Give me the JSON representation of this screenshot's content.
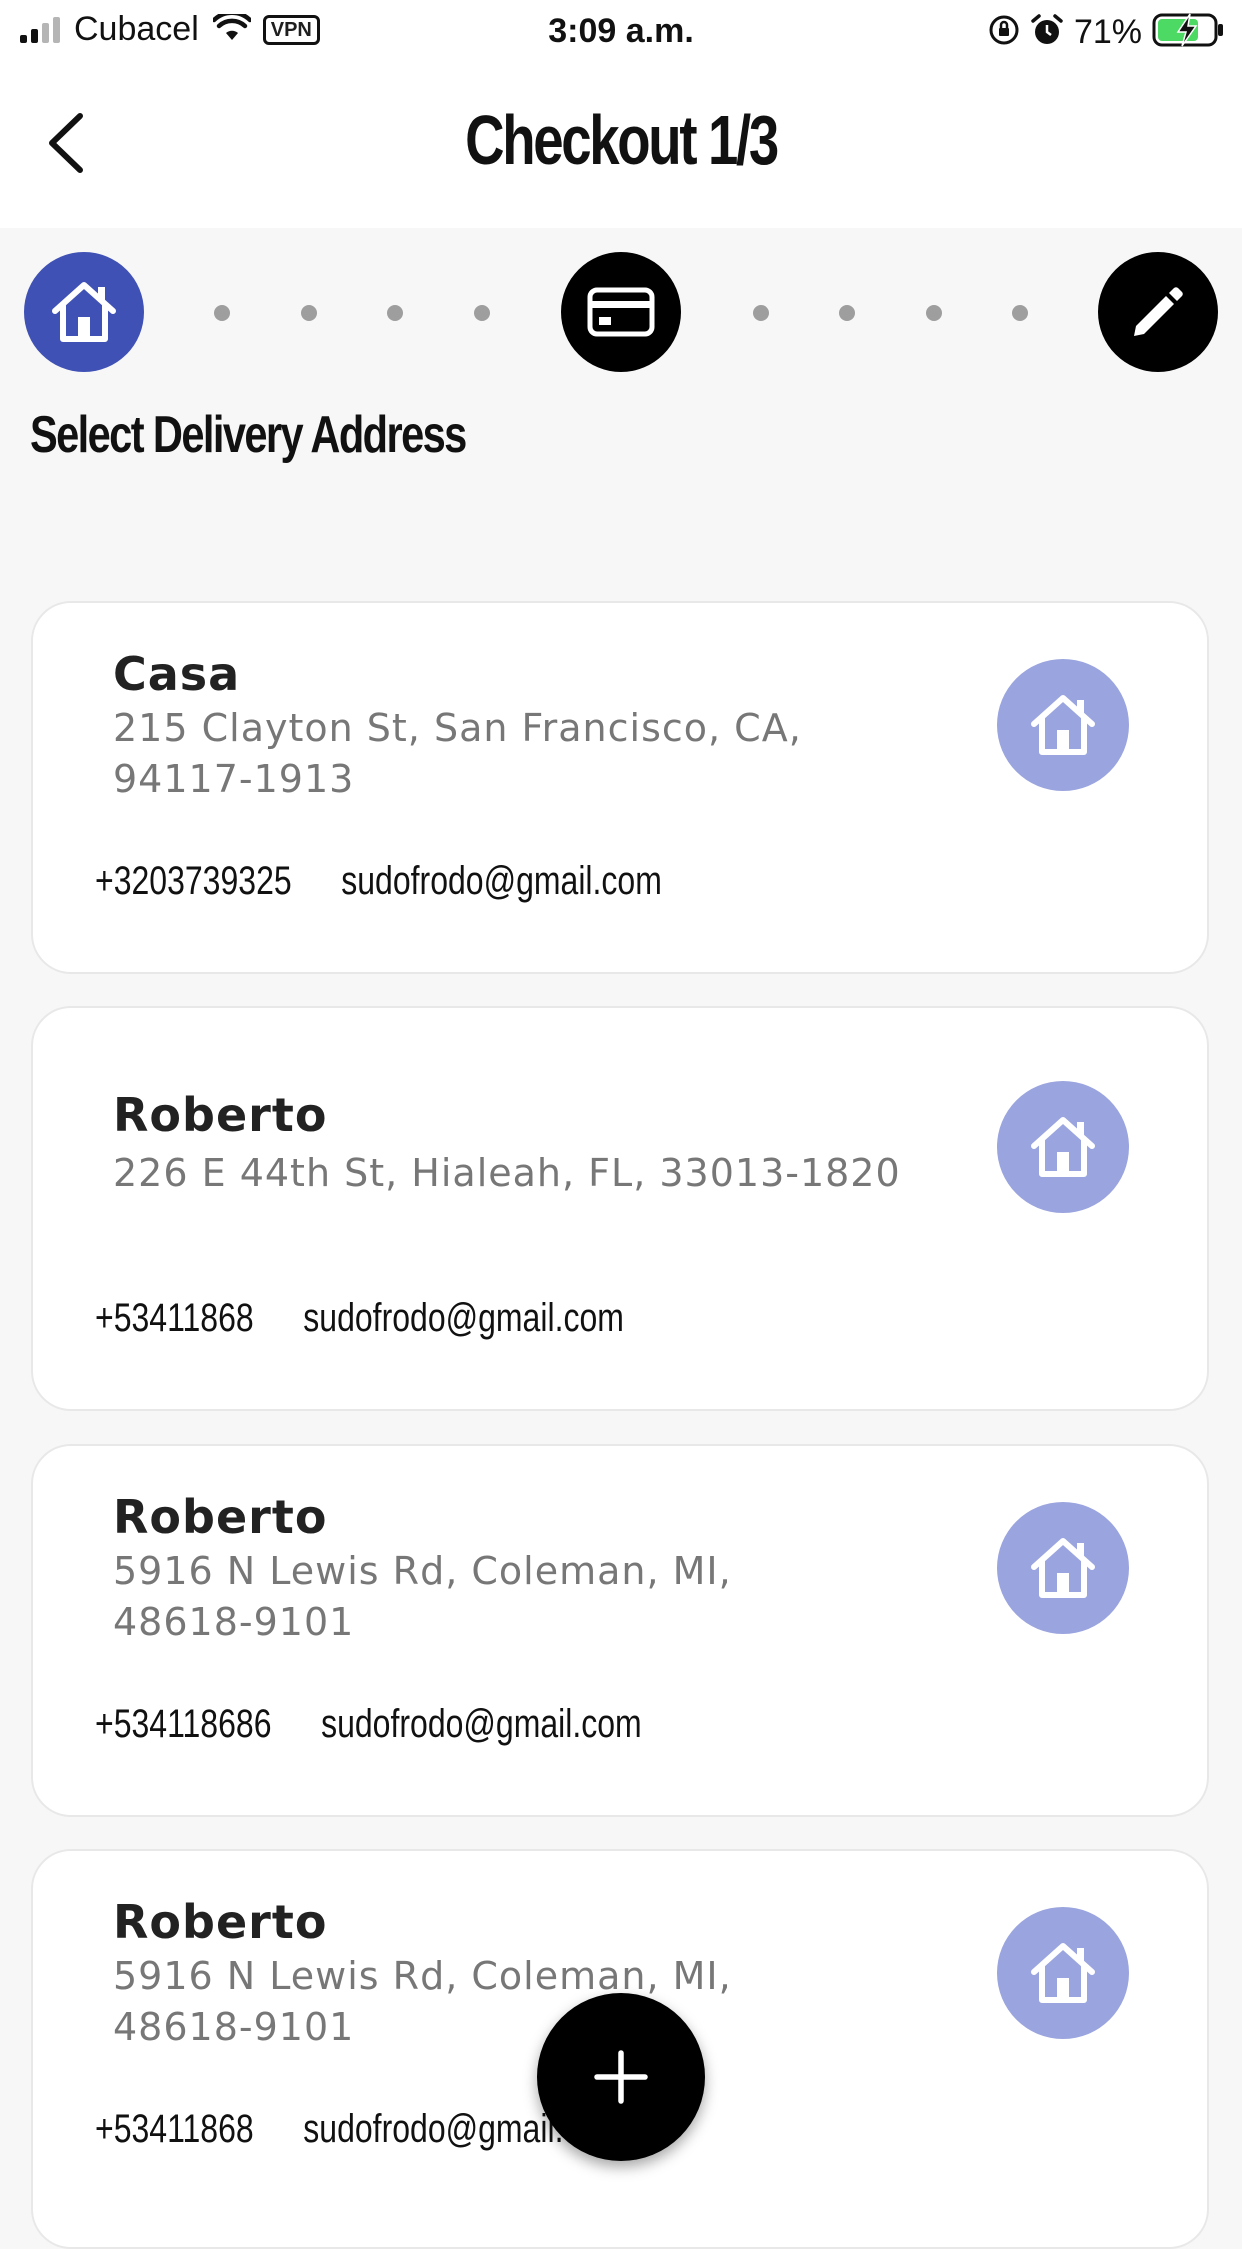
{
  "status_bar": {
    "carrier": "Cubacel",
    "vpn_label": "VPN",
    "time": "3:09 a.m.",
    "battery_percent": "71%"
  },
  "header": {
    "title": "Checkout 1/3"
  },
  "stepper": {
    "steps": [
      {
        "icon": "home-icon",
        "state": "active",
        "color": "#3f51b5"
      },
      {
        "icon": "card-icon",
        "state": "pending",
        "color": "#000000"
      },
      {
        "icon": "pencil-icon",
        "state": "pending",
        "color": "#000000"
      }
    ]
  },
  "section_title": "Select Delivery Address",
  "addresses": [
    {
      "name": "Casa",
      "address": "215 Clayton St, San Francisco, CA, 94117-1913",
      "phone": "+3203739325",
      "email": "sudofrodo@gmail.com"
    },
    {
      "name": "Roberto",
      "address": "226 E 44th St, Hialeah, FL, 33013-1820",
      "phone": "+53411868",
      "email": "sudofrodo@gmail.com"
    },
    {
      "name": "Roberto",
      "address": "5916 N Lewis Rd, Coleman, MI, 48618-9101",
      "phone": "+534118686",
      "email": "sudofrodo@gmail.com"
    },
    {
      "name": "Roberto",
      "address": "5916 N Lewis Rd, Coleman, MI, 48618-9101",
      "phone": "+53411868",
      "email": "sudofrodo@gmail.com"
    }
  ],
  "colors": {
    "accent": "#3f51b5",
    "address_icon_bg": "#9aa4de",
    "background": "#f7f7f7"
  }
}
